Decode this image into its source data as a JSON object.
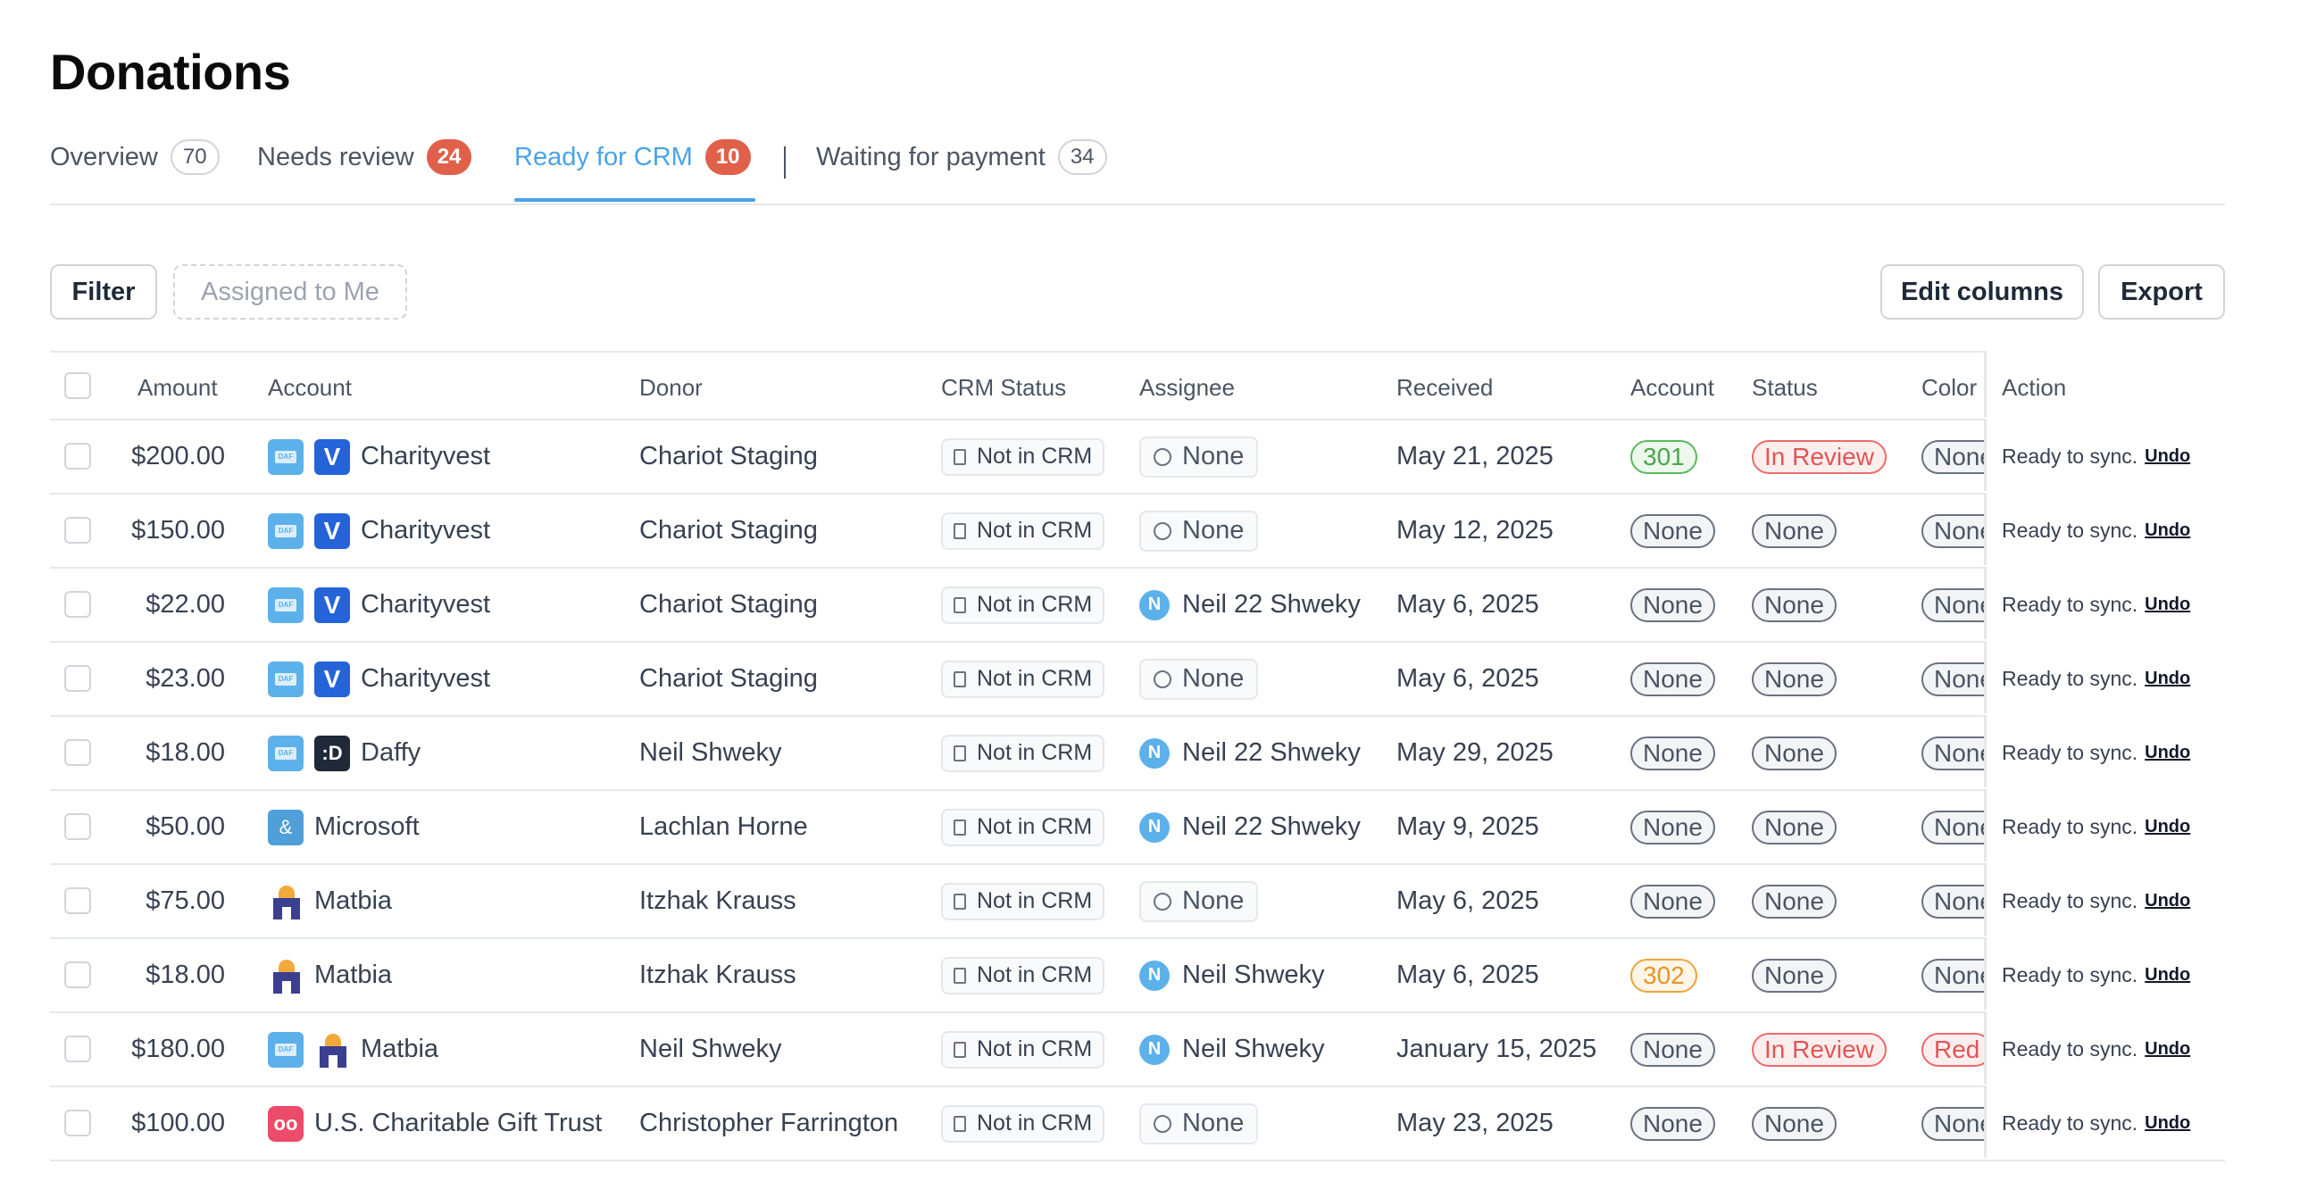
{
  "page": {
    "title": "Donations"
  },
  "tabs": [
    {
      "label": "Overview",
      "count": "70"
    },
    {
      "label": "Needs review",
      "count": "24"
    },
    {
      "label": "Ready for CRM",
      "count": "10"
    },
    {
      "label": "Waiting for payment",
      "count": "34"
    }
  ],
  "toolbar": {
    "filter": "Filter",
    "assigned": "Assigned to Me",
    "edit_columns": "Edit columns",
    "export": "Export"
  },
  "columns": {
    "amount": "Amount",
    "account": "Account",
    "donor": "Donor",
    "crm_status": "CRM Status",
    "assignee": "Assignee",
    "received": "Received",
    "account2": "Account",
    "status": "Status",
    "color": "Color",
    "action": "Action"
  },
  "rows": [
    {
      "amount": "$200.00",
      "account": "Charityvest",
      "donor": "Chariot Staging",
      "crm": "Not in CRM",
      "assignee": "None",
      "received": "May 21, 2025",
      "account_tag": "301",
      "status": "In Review",
      "color": "None",
      "action": "Ready to sync.",
      "undo": "Undo"
    },
    {
      "amount": "$150.00",
      "account": "Charityvest",
      "donor": "Chariot Staging",
      "crm": "Not in CRM",
      "assignee": "None",
      "received": "May 12, 2025",
      "account_tag": "None",
      "status": "None",
      "color": "None",
      "action": "Ready to sync.",
      "undo": "Undo"
    },
    {
      "amount": "$22.00",
      "account": "Charityvest",
      "donor": "Chariot Staging",
      "crm": "Not in CRM",
      "assignee": "Neil 22 Shweky",
      "initial": "N",
      "received": "May 6, 2025",
      "account_tag": "None",
      "status": "None",
      "color": "None",
      "action": "Ready to sync.",
      "undo": "Undo"
    },
    {
      "amount": "$23.00",
      "account": "Charityvest",
      "donor": "Chariot Staging",
      "crm": "Not in CRM",
      "assignee": "None",
      "received": "May 6, 2025",
      "account_tag": "None",
      "status": "None",
      "color": "None",
      "action": "Ready to sync.",
      "undo": "Undo"
    },
    {
      "amount": "$18.00",
      "account": "Daffy",
      "donor": "Neil Shweky",
      "crm": "Not in CRM",
      "assignee": "Neil 22 Shweky",
      "initial": "N",
      "received": "May 29, 2025",
      "account_tag": "None",
      "status": "None",
      "color": "None",
      "action": "Ready to sync.",
      "undo": "Undo"
    },
    {
      "amount": "$50.00",
      "account": "Microsoft",
      "donor": "Lachlan Horne",
      "crm": "Not in CRM",
      "assignee": "Neil 22 Shweky",
      "initial": "N",
      "received": "May 9, 2025",
      "account_tag": "None",
      "status": "None",
      "color": "None",
      "action": "Ready to sync.",
      "undo": "Undo"
    },
    {
      "amount": "$75.00",
      "account": "Matbia",
      "donor": "Itzhak Krauss",
      "crm": "Not in CRM",
      "assignee": "None",
      "received": "May 6, 2025",
      "account_tag": "None",
      "status": "None",
      "color": "None",
      "action": "Ready to sync.",
      "undo": "Undo"
    },
    {
      "amount": "$18.00",
      "account": "Matbia",
      "donor": "Itzhak Krauss",
      "crm": "Not in CRM",
      "assignee": "Neil Shweky",
      "initial": "N",
      "received": "May 6, 2025",
      "account_tag": "302",
      "status": "None",
      "color": "None",
      "action": "Ready to sync.",
      "undo": "Undo"
    },
    {
      "amount": "$180.00",
      "account": "Matbia",
      "donor": "Neil Shweky",
      "crm": "Not in CRM",
      "assignee": "Neil Shweky",
      "initial": "N",
      "received": "January 15, 2025",
      "account_tag": "None",
      "status": "In Review",
      "color": "Red",
      "action": "Ready to sync.",
      "undo": "Undo"
    },
    {
      "amount": "$100.00",
      "account": "U.S. Charitable Gift Trust",
      "donor": "Christopher Farrington",
      "crm": "Not in CRM",
      "assignee": "None",
      "received": "May 23, 2025",
      "account_tag": "None",
      "status": "None",
      "color": "None",
      "action": "Ready to sync.",
      "undo": "Undo"
    }
  ],
  "icons": {
    "daf": "DAF",
    "charityvest": "V",
    "daffy": ":D",
    "microsoft": "&",
    "usc": "oo"
  },
  "colors": {
    "accent": "#4aa3e8",
    "badge_red": "#e0604a",
    "green": "#4ba54b",
    "orange": "#e69528",
    "red": "#e45454"
  }
}
